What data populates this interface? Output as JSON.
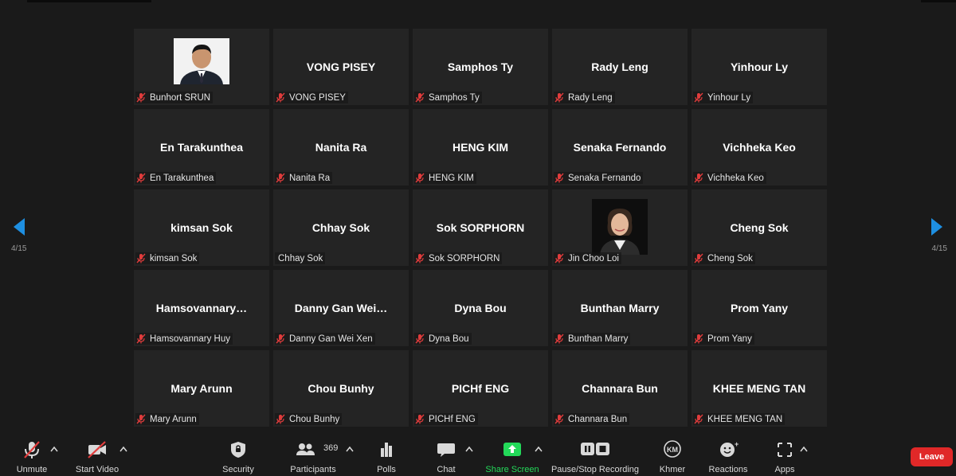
{
  "participants": [
    {
      "display": "",
      "label": "Bunhort SRUN",
      "photo": "man-in-suit",
      "muted": true
    },
    {
      "display": "VONG PISEY",
      "label": "VONG PISEY",
      "muted": true
    },
    {
      "display": "Samphos Ty",
      "label": "Samphos Ty",
      "muted": true
    },
    {
      "display": "Rady Leng",
      "label": "Rady Leng",
      "muted": true
    },
    {
      "display": "Yinhour Ly",
      "label": "Yinhour Ly",
      "muted": true
    },
    {
      "display": "En Tarakunthea",
      "label": "En Tarakunthea",
      "muted": true
    },
    {
      "display": "Nanita Ra",
      "label": "Nanita Ra",
      "muted": true
    },
    {
      "display": "HENG KIM",
      "label": "HENG KIM",
      "muted": true
    },
    {
      "display": "Senaka Fernando",
      "label": "Senaka Fernando",
      "muted": true
    },
    {
      "display": "Vichheka Keo",
      "label": "Vichheka Keo",
      "muted": true
    },
    {
      "display": "kimsan Sok",
      "label": "kimsan Sok",
      "muted": true
    },
    {
      "display": "Chhay Sok",
      "label": "Chhay Sok",
      "muted": false
    },
    {
      "display": "Sok SORPHORN",
      "label": "Sok SORPHORN",
      "muted": true
    },
    {
      "display": "",
      "label": "Jin Choo Loi",
      "photo": "woman-portrait",
      "muted": true
    },
    {
      "display": "Cheng Sok",
      "label": "Cheng Sok",
      "muted": true
    },
    {
      "display": "Hamsovannary…",
      "label": "Hamsovannary Huy",
      "muted": true
    },
    {
      "display": "Danny Gan Wei…",
      "label": "Danny Gan Wei Xen",
      "muted": true
    },
    {
      "display": "Dyna Bou",
      "label": "Dyna Bou",
      "muted": true
    },
    {
      "display": "Bunthan Marry",
      "label": "Bunthan Marry",
      "muted": true
    },
    {
      "display": "Prom Yany",
      "label": "Prom Yany",
      "muted": true
    },
    {
      "display": "Mary Arunn",
      "label": "Mary Arunn",
      "muted": true
    },
    {
      "display": "Chou Bunhy",
      "label": "Chou Bunhy",
      "muted": true
    },
    {
      "display": "PICHf ENG",
      "label": "PICHf ENG",
      "muted": true
    },
    {
      "display": "Channara Bun",
      "label": "Channara Bun",
      "muted": true
    },
    {
      "display": "KHEE MENG TAN",
      "label": "KHEE MENG TAN",
      "muted": true
    }
  ],
  "pagination": {
    "left": "4/15",
    "right": "4/15"
  },
  "toolbar": {
    "unmute": "Unmute",
    "start_video": "Start Video",
    "security": "Security",
    "participants": "Participants",
    "participants_count": "369",
    "polls": "Polls",
    "chat": "Chat",
    "share_screen": "Share Screen",
    "recording": "Pause/Stop Recording",
    "khmer": "Khmer",
    "khmer_badge": "KM",
    "reactions": "Reactions",
    "apps": "Apps",
    "leave": "Leave"
  },
  "colors": {
    "background": "#1a1a1a",
    "tile": "#242424",
    "share_green": "#23d959",
    "leave_red": "#e02828",
    "nav_blue": "#1e8fe1",
    "muted_red": "#e03c3c"
  },
  "icons": {
    "muted_mic": "mic-muted-icon",
    "nav_prev": "arrow-left-icon",
    "nav_next": "arrow-right-icon"
  }
}
